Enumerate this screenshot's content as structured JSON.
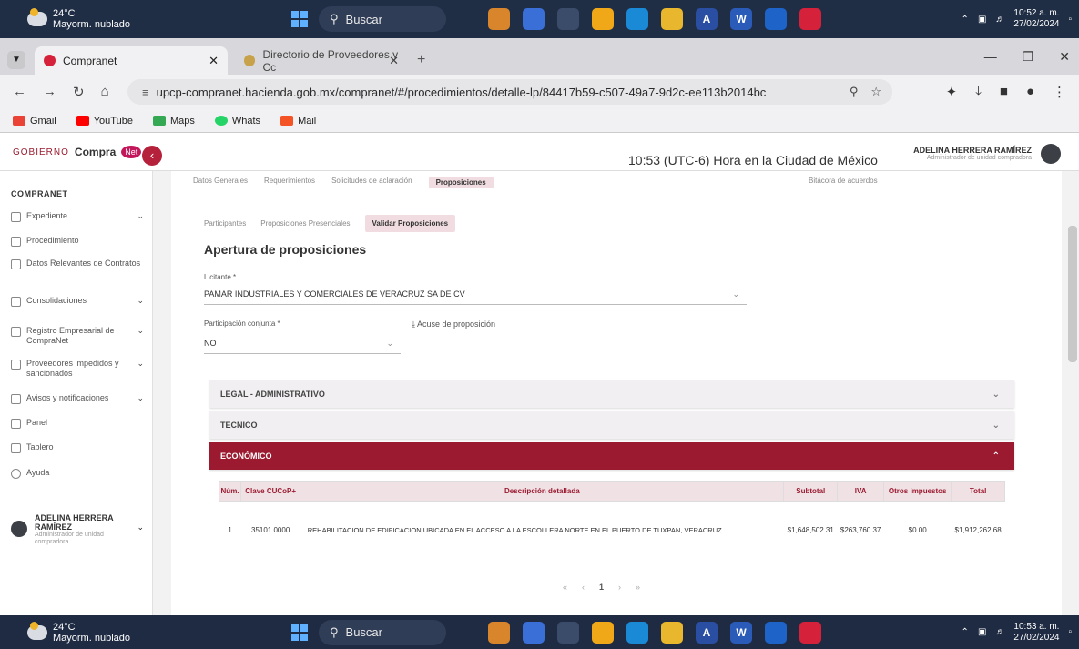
{
  "taskbar_top": {
    "temp": "24°C",
    "weather": "Mayorm. nublado",
    "search": "Buscar",
    "time": "10:52 a. m.",
    "date": "27/02/2024"
  },
  "taskbar_bottom": {
    "temp": "24°C",
    "weather": "Mayorm. nublado",
    "search": "Buscar",
    "time": "10:53 a. m.",
    "date": "27/02/2024"
  },
  "taskbar_apps": [
    {
      "name": "app-vlc",
      "color": "#d9852b",
      "glyph": ""
    },
    {
      "name": "app-tasks",
      "color": "#3a6fd8",
      "glyph": ""
    },
    {
      "name": "app-webcam",
      "color": "#3b4b6a",
      "glyph": ""
    },
    {
      "name": "app-chrome",
      "color": "#f0a818",
      "glyph": ""
    },
    {
      "name": "app-edge",
      "color": "#1b8ad6",
      "glyph": ""
    },
    {
      "name": "app-explorer",
      "color": "#e8b72d",
      "glyph": ""
    },
    {
      "name": "app-acrobat",
      "color": "#2a4ea1",
      "glyph": "A"
    },
    {
      "name": "app-word",
      "color": "#2b5bb8",
      "glyph": "W"
    },
    {
      "name": "app-security",
      "color": "#1e63c8",
      "glyph": ""
    },
    {
      "name": "app-adobe",
      "color": "#d6213b",
      "glyph": ""
    }
  ],
  "browser": {
    "tab_active": "Compranet",
    "tab_inactive": "Directorio de Proveedores y Cc",
    "url": "upcp-compranet.hacienda.gob.mx/compranet/#/procedimientos/detalle-lp/84417b59-c507-49a7-9d2c-ee113b2014bc",
    "bookmarks": [
      "Gmail",
      "YouTube",
      "Maps",
      "Whats",
      "Mail"
    ]
  },
  "header": {
    "logo_gob": "GOBIERNO",
    "logo_name": "Compra",
    "logo_net": "Net",
    "time": "10:53 (UTC-6) Hora en la Ciudad de México",
    "user": "ADELINA HERRERA RAMÍREZ",
    "role": "Administrador de unidad compradora"
  },
  "sidebar": {
    "title": "COMPRANET",
    "items": [
      "Expediente",
      "Procedimiento",
      "Datos Relevantes de Contratos",
      "Consolidaciones",
      "Registro Empresarial de CompraNet",
      "Proveedores impedidos y sancionados",
      "Avisos y notificaciones",
      "Panel",
      "Tablero",
      "Ayuda"
    ],
    "user_name": "ADELINA HERRERA RAMÍREZ",
    "user_role": "Administrador de unidad compradora"
  },
  "tabs_top": [
    "Datos Generales",
    "Requerimientos",
    "Solicitudes de aclaración",
    "Proposiciones"
  ],
  "tabs_top_right": "Bitácora de acuerdos",
  "tabs_sub": [
    "Participantes",
    "Proposiciones Presenciales",
    "Validar Proposiciones"
  ],
  "form": {
    "title": "Apertura de proposiciones",
    "licitante_label": "Licitante *",
    "licitante_value": "PAMAR INDUSTRIALES Y COMERCIALES DE VERACRUZ SA DE CV",
    "conjunta_label": "Participación conjunta *",
    "conjunta_value": "NO",
    "acuse": "Acuse de proposición"
  },
  "sections": [
    "LEGAL - ADMINISTRATIVO",
    "TECNICO",
    "ECONÓMICO"
  ],
  "table": {
    "headers": [
      "Núm.",
      "Clave CUCoP+",
      "Descripción detallada",
      "Subtotal",
      "IVA",
      "Otros impuestos",
      "Total"
    ],
    "rows": [
      [
        "1",
        "35101 0000",
        "REHABILITACION DE EDIFICACION UBICADA EN EL ACCESO A LA ESCOLLERA NORTE EN EL PUERTO DE TUXPAN, VERACRUZ",
        "$1,648,502.31",
        "$263,760.37",
        "$0.00",
        "$1,912,262.68"
      ]
    ]
  },
  "pager": [
    "«",
    "‹",
    "1",
    "›",
    "»"
  ]
}
